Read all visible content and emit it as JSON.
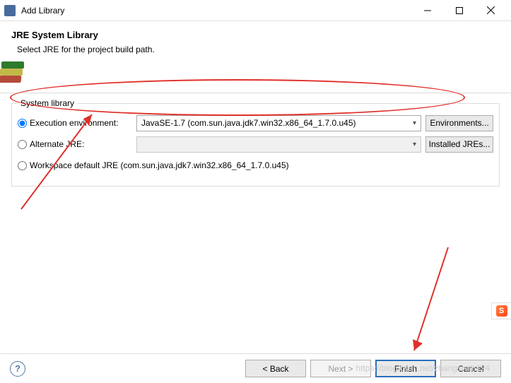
{
  "titlebar": {
    "title": "Add Library"
  },
  "header": {
    "title": "JRE System Library",
    "subtitle": "Select JRE for the project build path."
  },
  "systemLibrary": {
    "groupLabel": "System library",
    "options": {
      "execution": {
        "label": "Execution environment:",
        "selected": true,
        "value": "JavaSE-1.7 (com.sun.java.jdk7.win32.x86_64_1.7.0.u45)",
        "button": "Environments..."
      },
      "alternate": {
        "label": "Alternate JRE:",
        "selected": false,
        "value": "",
        "button": "Installed JREs..."
      },
      "workspace": {
        "label": "Workspace default JRE (com.sun.java.jdk7.win32.x86_64_1.7.0.u45)",
        "selected": false
      }
    }
  },
  "footer": {
    "back": "< Back",
    "next": "Next >",
    "finish": "Finish",
    "cancel": "Cancel"
  },
  "watermark": "https://blog.csdn.net/zhangshah124",
  "sogou": "S"
}
